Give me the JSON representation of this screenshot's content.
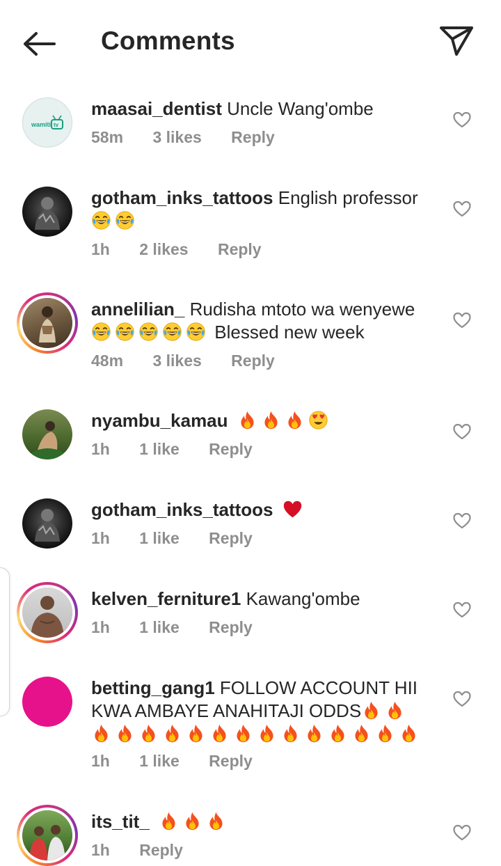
{
  "header": {
    "title": "Comments",
    "back_icon": "back-arrow-icon",
    "send_icon": "paper-plane-icon"
  },
  "reply_label": "Reply",
  "comments": [
    {
      "username": "maasai_dentist",
      "text": "Uncle Wang'ombe",
      "time": "58m",
      "likes": "3 likes",
      "avatar_label": "wamiti",
      "avatar_badge": "tv"
    },
    {
      "username": "gotham_inks_tattoos",
      "text": "English professor",
      "time": "1h",
      "likes": "2 likes"
    },
    {
      "username": "annelilian_",
      "text": "Rudisha mtoto wa wenyewe",
      "text_after": "Blessed new week",
      "time": "48m",
      "likes": "3 likes"
    },
    {
      "username": "nyambu_kamau",
      "text": "",
      "time": "1h",
      "likes": "1 like"
    },
    {
      "username": "gotham_inks_tattoos",
      "text": "",
      "time": "1h",
      "likes": "1 like"
    },
    {
      "username": "kelven_ferniture1",
      "text": "Kawang'ombe",
      "time": "1h",
      "likes": "1 like"
    },
    {
      "username": "betting_gang1",
      "text": "FOLLOW ACCOUNT HII KWA AMBAYE ANAHITAJI ODDS",
      "time": "1h",
      "likes": "1 like",
      "avatar_color": "#e6128c"
    },
    {
      "username": "its_tit_",
      "text": "",
      "time": "1h",
      "likes": ""
    }
  ]
}
